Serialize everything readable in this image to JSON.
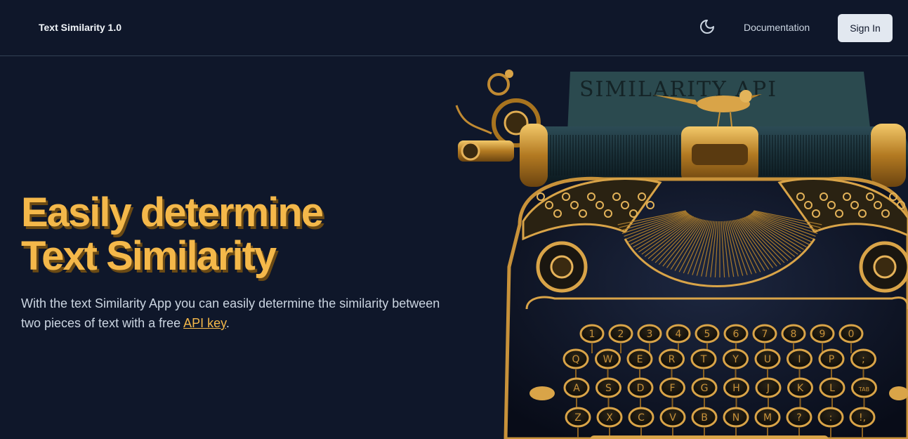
{
  "header": {
    "brand": "Text Similarity 1.0",
    "theme_icon": "moon-icon",
    "docs_label": "Documentation",
    "signin_label": "Sign In"
  },
  "hero": {
    "title_line1": "Easily determine",
    "title_line2": "Text Similarity",
    "description_prefix": "With the text Similarity App you can easily determine the similarity between two pieces of text with a free ",
    "api_link": "API key",
    "description_suffix": "."
  },
  "image": {
    "paper_text": "SIMILARITY API",
    "number_keys": [
      "1",
      "2",
      "3",
      "4",
      "5",
      "6",
      "7",
      "8",
      "9",
      "0"
    ],
    "row1_keys": [
      "Q",
      "W",
      "E",
      "R",
      "T",
      "Y",
      "U",
      "I",
      "P",
      ";"
    ],
    "row2_keys": [
      "A",
      "S",
      "D",
      "F",
      "G",
      "H",
      "J",
      "K",
      "L",
      "TAB"
    ],
    "row3_keys": [
      "Z",
      "X",
      "C",
      "V",
      "B",
      "N",
      "M",
      "?",
      ":",
      "!,"
    ]
  },
  "colors": {
    "background": "#0f172a",
    "accent": "#f4b84a",
    "brass": "#c8923a"
  }
}
